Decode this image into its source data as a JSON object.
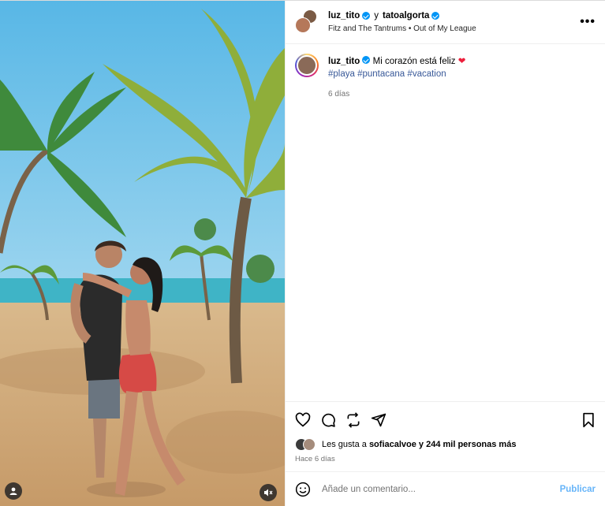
{
  "colors": {
    "accent": "#0095f6",
    "heart": "#ed1f3c",
    "publish": "#67b5f9"
  },
  "header": {
    "user1": "luz_tito",
    "connector": "y",
    "user2": "tatoalgorta",
    "song": "Fitz and The Tantrums • Out of My League",
    "more_icon": "more-horizontal-icon"
  },
  "caption": {
    "username": "luz_tito",
    "text": "Mi corazón está feliz",
    "emoji": "❤",
    "hashtags": [
      "#playa",
      "#puntacana",
      "#vacation"
    ],
    "time": "6 días"
  },
  "actions": {
    "icons": [
      "heart-icon",
      "comment-icon",
      "share-icon",
      "send-icon",
      "bookmark-icon"
    ]
  },
  "likes": {
    "prefix": "Les gusta a",
    "user": "sofiacalvoe",
    "suffix": "y 244 mil personas más"
  },
  "post_time": "Hace 6 días",
  "comment": {
    "placeholder": "Añade un comentario...",
    "publish_label": "Publicar"
  },
  "media": {
    "alt": "Pareja abrazada en la playa bajo palmeras"
  }
}
